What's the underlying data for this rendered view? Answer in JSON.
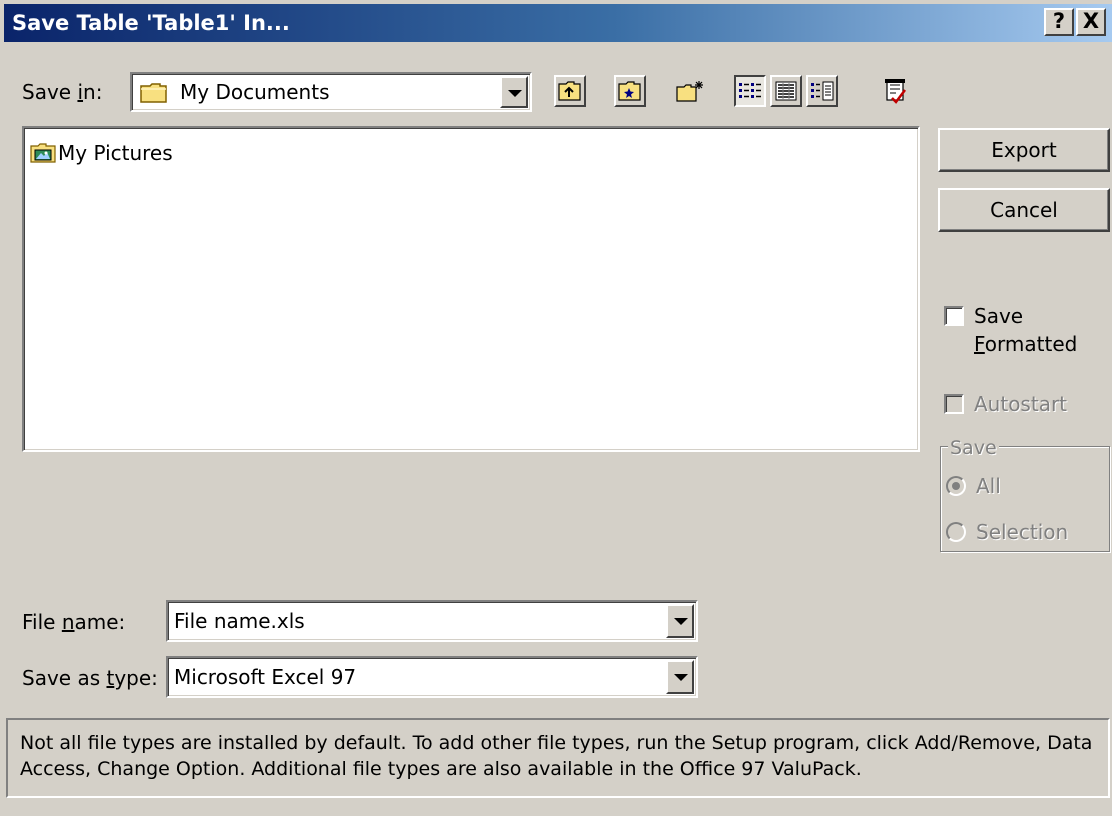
{
  "window": {
    "title": "Save Table 'Table1' In...",
    "help_glyph": "?",
    "close_glyph": "X"
  },
  "save_in": {
    "label_pre": "Save ",
    "label_accel": "i",
    "label_post": "n:",
    "value": "My Documents",
    "icon": "folder-icon"
  },
  "toolbar": {
    "buttons": [
      {
        "name": "up-one-level-icon"
      },
      {
        "name": "look-in-favorites-icon"
      },
      {
        "name": "create-new-folder-icon"
      },
      {
        "name": "list-view-icon",
        "pressed": true
      },
      {
        "name": "details-view-icon"
      },
      {
        "name": "properties-view-icon"
      },
      {
        "name": "commands-and-settings-icon"
      }
    ]
  },
  "file_list": {
    "items": [
      {
        "label": "My Pictures",
        "icon": "pictures-folder-icon"
      }
    ]
  },
  "buttons": {
    "export": "Export",
    "cancel": "Cancel"
  },
  "options": {
    "save_formatted_line1": "Save",
    "save_formatted_accel": "F",
    "save_formatted_rest": "ormatted",
    "autostart": "Autostart",
    "save_group": "Save",
    "all": "All",
    "selection": "Selection"
  },
  "file_name": {
    "label_pre": "File ",
    "label_accel": "n",
    "label_post": "ame:",
    "value": "File name.xls"
  },
  "save_as_type": {
    "label_pre": "Save as ",
    "label_accel": "t",
    "label_post": "ype:",
    "value": "Microsoft Excel 97"
  },
  "info": {
    "text": "Not all file types are installed by default.  To add other file types, run the Setup program, click Add/Remove, Data Access, Change Option.  Additional file types are also available in the Office 97 ValuPack."
  },
  "colors": {
    "title_start": "#0a246a",
    "title_end": "#a6caf0",
    "face": "#d4d0c8"
  }
}
